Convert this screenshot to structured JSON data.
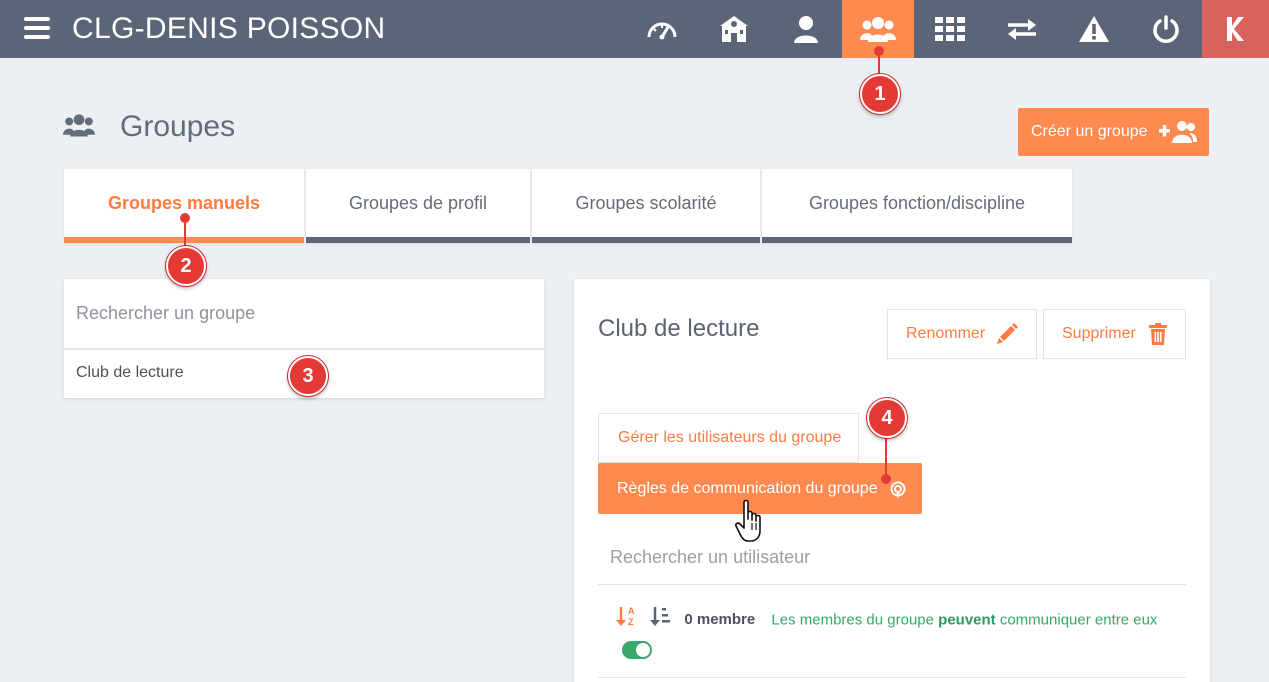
{
  "app": {
    "title": "CLG-DENIS POISSON",
    "nav": [
      {
        "name": "dashboard-icon"
      },
      {
        "name": "school-icon"
      },
      {
        "name": "user-icon"
      },
      {
        "name": "groups-icon",
        "active": true
      },
      {
        "name": "apps-grid-icon"
      },
      {
        "name": "transfer-icon"
      },
      {
        "name": "warning-icon"
      },
      {
        "name": "power-icon"
      },
      {
        "name": "logo-k-icon"
      }
    ]
  },
  "page": {
    "title": "Groupes",
    "create_button": "Créer un groupe"
  },
  "tabs": [
    {
      "label": "Groupes manuels",
      "active": true
    },
    {
      "label": "Groupes de profil"
    },
    {
      "label": "Groupes scolarité"
    },
    {
      "label": "Groupes fonction/discipline"
    }
  ],
  "left": {
    "search_placeholder": "Rechercher un groupe",
    "groups": [
      "Club de lecture"
    ]
  },
  "detail": {
    "name": "Club de lecture",
    "rename_button": "Renommer",
    "delete_button": "Supprimer",
    "manage_users_button": "Gérer les utilisateurs du groupe",
    "rules_button": "Règles de communication du groupe",
    "user_search_placeholder": "Rechercher un utilisateur",
    "member_count": "0 membre",
    "comm_text_before": "Les membres du groupe",
    "comm_text_bold": "peuvent",
    "comm_text_after": "communiquer entre eux",
    "comm_toggle_on": true
  },
  "markers": [
    "1",
    "2",
    "3",
    "4"
  ],
  "colors": {
    "topbar": "#5b6577",
    "accent": "#ff8a50",
    "exit": "#d9625c",
    "marker": "#e53935",
    "green": "#3aa76d"
  }
}
